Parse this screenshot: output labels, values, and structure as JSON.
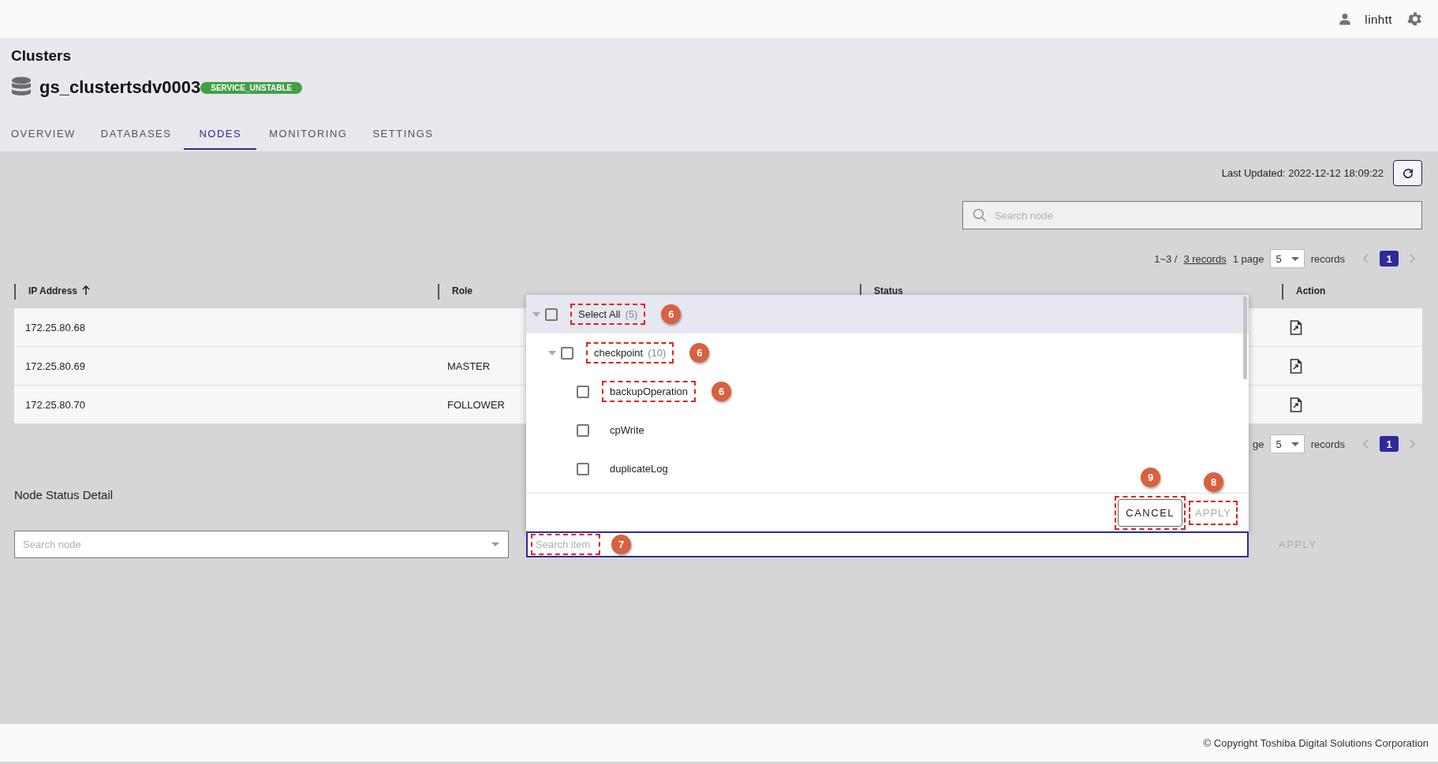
{
  "top_bar": {
    "user": "linhtt"
  },
  "header": {
    "title": "Clusters",
    "cluster_name": "gs_clustertsdv0003",
    "status_badge": "SERVICE_UNSTABLE"
  },
  "tabs": [
    {
      "label": "OVERVIEW",
      "selected": false
    },
    {
      "label": "DATABASES",
      "selected": false
    },
    {
      "label": "NODES",
      "selected": true
    },
    {
      "label": "MONITORING",
      "selected": false
    },
    {
      "label": "SETTINGS",
      "selected": false
    }
  ],
  "last_updated": "Last Updated: 2022-12-12 18:09:22",
  "search": {
    "placeholder": "Search node"
  },
  "pagination_top": {
    "range": "1~3 /",
    "records_link": "3 records",
    "page_label": "1 page",
    "page_size": "5",
    "unit": "records",
    "pages": [
      {
        "label": "1",
        "selected": true
      }
    ]
  },
  "table": {
    "columns": [
      {
        "label": "IP Address",
        "sorted_ascending": true
      },
      {
        "label": "Role"
      },
      {
        "label": "Status"
      },
      {
        "label": "Action"
      }
    ],
    "rows": [
      {
        "ip_address": "172.25.80.68"
      },
      {
        "ip_address": "172.25.80.69",
        "role": "MASTER"
      },
      {
        "ip_address": "172.25.80.70",
        "role": "FOLLOWER"
      }
    ]
  },
  "pagination_bottom": {
    "page_label": "ge",
    "page_size": "5",
    "unit": "records",
    "pages": [
      {
        "label": "1",
        "selected": true
      }
    ]
  },
  "node_status_detail": {
    "title": "Node Status Detail",
    "node_select": {
      "placeholder": "Search node"
    },
    "item_search": {
      "placeholder": "Search item",
      "callout": "7"
    },
    "apply": {
      "label": "APPLY",
      "disabled": true
    }
  },
  "item_dropdown": {
    "items": [
      {
        "label": "Select All",
        "count": "(5)",
        "checked": false,
        "expanded": true,
        "highlighted": true,
        "callout": "6",
        "children": [
          {
            "label": "checkpoint",
            "count": "(10)",
            "checked": false,
            "expanded": true,
            "highlighted": false,
            "callout": "6",
            "children": [
              {
                "label": "backupOperation",
                "checked": false,
                "highlighted": false,
                "callout": "6"
              },
              {
                "label": "cpWrite",
                "checked": false,
                "highlighted": false
              },
              {
                "label": "duplicateLog",
                "checked": false,
                "highlighted": false
              }
            ]
          }
        ]
      }
    ],
    "cancel": {
      "label": "CANCEL",
      "callout": "9"
    },
    "apply": {
      "label": "APPLY",
      "disabled": true,
      "callout": "8"
    }
  },
  "footer": "© Copyright Toshiba Digital Solutions Corporation"
}
